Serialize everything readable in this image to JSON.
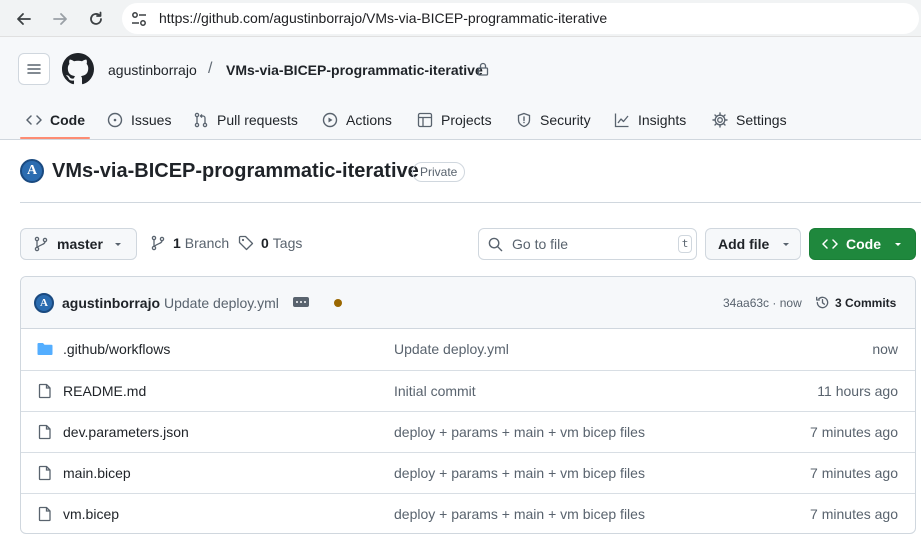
{
  "browser": {
    "url": "https://github.com/agustinborrajo/VMs-via-BICEP-programmatic-iterative"
  },
  "header": {
    "owner": "agustinborrajo",
    "separator": "/",
    "repo": "VMs-via-BICEP-programmatic-iterative"
  },
  "tabs": [
    {
      "label": "Code",
      "icon": "code-icon",
      "active": true
    },
    {
      "label": "Issues",
      "icon": "issue-icon"
    },
    {
      "label": "Pull requests",
      "icon": "pull-request-icon"
    },
    {
      "label": "Actions",
      "icon": "play-icon"
    },
    {
      "label": "Projects",
      "icon": "table-icon"
    },
    {
      "label": "Security",
      "icon": "shield-icon"
    },
    {
      "label": "Insights",
      "icon": "graph-icon"
    },
    {
      "label": "Settings",
      "icon": "gear-icon"
    }
  ],
  "repo": {
    "avatar_letter": "A",
    "title": "VMs-via-BICEP-programmatic-iterative",
    "visibility": "Private"
  },
  "toolbar": {
    "branch": "master",
    "branch_count": "1",
    "branch_label": "Branch",
    "tag_count": "0",
    "tag_label": "Tags",
    "search_placeholder": "Go to file",
    "search_shortcut": "t",
    "add_file": "Add file",
    "code": "Code"
  },
  "latest_commit": {
    "author": "agustinborrajo",
    "message": "Update deploy.yml",
    "hash": "34aa63c",
    "separator": "·",
    "time": "now",
    "commits_label": "3 Commits",
    "status_color": "#9a6700"
  },
  "files": [
    {
      "name": ".github/workflows",
      "type": "folder",
      "commit": "Update deploy.yml",
      "time": "now"
    },
    {
      "name": "README.md",
      "type": "file",
      "commit": "Initial commit",
      "time": "11 hours ago"
    },
    {
      "name": "dev.parameters.json",
      "type": "file",
      "commit": "deploy + params + main + vm bicep files",
      "time": "7 minutes ago"
    },
    {
      "name": "main.bicep",
      "type": "file",
      "commit": "deploy + params + main + vm bicep files",
      "time": "7 minutes ago"
    },
    {
      "name": "vm.bicep",
      "type": "file",
      "commit": "deploy + params + main + vm bicep files",
      "time": "7 minutes ago"
    }
  ],
  "colors": {
    "accent_green": "#1f883d",
    "active_tab_underline": "#fd8c73",
    "folder_blue": "#54aeff"
  }
}
